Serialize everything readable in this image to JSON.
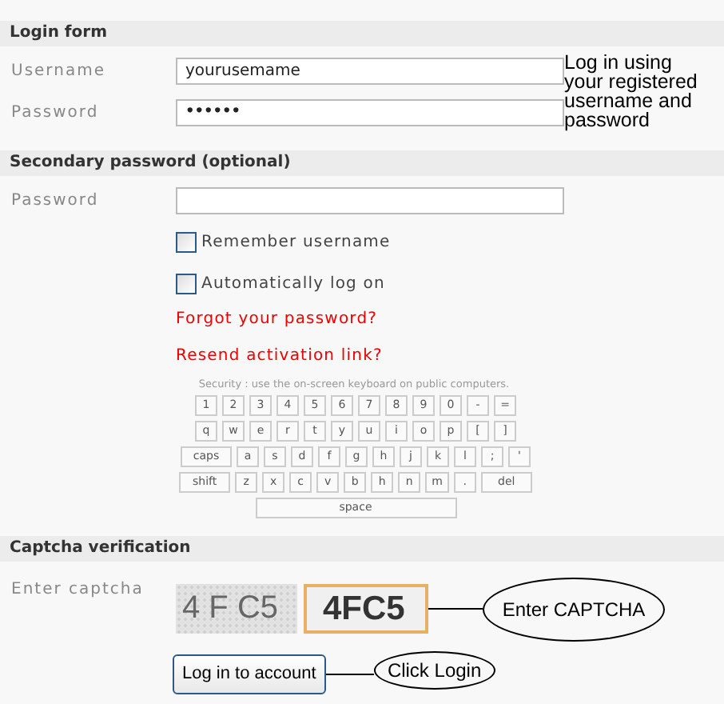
{
  "login_form": {
    "title": "Login form",
    "fields": [
      {
        "label": "Username",
        "value": "yourusemame",
        "kind": "text"
      },
      {
        "label": "Password",
        "value": "••••••",
        "kind": "password"
      }
    ],
    "note": "Log in using your registered username and password"
  },
  "secondary": {
    "title": "Secondary password (optional)",
    "field": {
      "label": "Password"
    },
    "options": [
      {
        "label": "Remember username",
        "checked": false
      },
      {
        "label": "Automatically log on",
        "checked": false
      }
    ],
    "links": [
      "Forgot your password?",
      "Resend activation link?"
    ],
    "keyboard": {
      "hint": "Security : use the on-screen keyboard on public computers.",
      "key_rows": [
        {
          "keys": [
            "1",
            "2",
            "3",
            "4",
            "5",
            "6",
            "7",
            "8",
            "9",
            "0",
            "-",
            "="
          ]
        },
        {
          "keys": [
            "q",
            "w",
            "e",
            "r",
            "t",
            "y",
            "u",
            "i",
            "o",
            "p",
            "[",
            "]"
          ]
        },
        {
          "keys": [
            "caps",
            "a",
            "s",
            "d",
            "f",
            "g",
            "h",
            "j",
            "k",
            "l",
            ";",
            "'"
          ]
        },
        {
          "keys": [
            "shift",
            "z",
            "x",
            "c",
            "v",
            "b",
            "h",
            "n",
            "m",
            ".",
            "del"
          ]
        },
        {
          "keys": [
            "space"
          ]
        }
      ]
    }
  },
  "captcha": {
    "title": "Captcha verification",
    "label": "Enter captcha",
    "image_text": "4 F C5",
    "value": "4FC5",
    "callout": "Enter CAPTCHA"
  },
  "submit": {
    "label": "Log in to account",
    "callout": "Click Login"
  }
}
